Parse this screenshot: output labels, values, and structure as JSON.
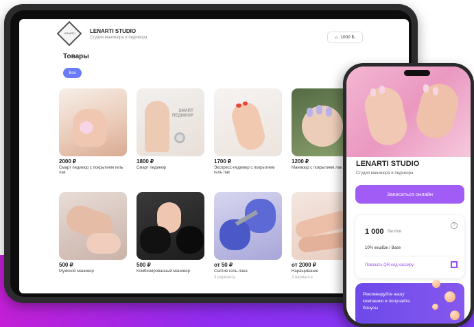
{
  "tablet": {
    "brand": "LENARTI STUDIO",
    "brand_sub": "Студия маникюра и педикюра",
    "logo_text": "LENARTI",
    "points": "1000 Б.",
    "section_title": "Товары",
    "filter_chip": "Все",
    "products": [
      {
        "price": "2000 ₽",
        "name": "Смарт педикюр с покрытием гель лак",
        "sub": ""
      },
      {
        "price": "1800 ₽",
        "name": "Смарт педикюр",
        "sub": "",
        "overlay": "SMART\nПЕДИКЮР"
      },
      {
        "price": "1700 ₽",
        "name": "Экспресс-педикюр с покрытием гель лак",
        "sub": ""
      },
      {
        "price": "1200 ₽",
        "name": "Маникюр с покрытием лак",
        "sub": ""
      },
      {
        "price": "500 ₽",
        "name": "Мужской маникюр",
        "sub": ""
      },
      {
        "price": "500 ₽",
        "name": "Комбинированный маникюр",
        "sub": ""
      },
      {
        "price": "от 50 ₽",
        "name": "Снятие гель-лака",
        "sub": "3 варианта"
      },
      {
        "price": "от 2000 ₽",
        "name": "Наращивание",
        "sub": "3 варианта"
      }
    ]
  },
  "phone": {
    "title": "LENARTI STUDIO",
    "subtitle": "Студия маникюра и педикюра",
    "book_button": "Записаться онлайн",
    "bonus_value": "1 000",
    "bonus_unit": "баллов",
    "cashback": "10% кешбэк / Base",
    "qr_link": "Показать QR-код кассиру",
    "promo": "Рекомендуйте нашу компанию и получайте бонусы"
  },
  "colors": {
    "accent": "#a25cf6",
    "chip": "#6a7bf7",
    "stripe_left": "#c21fd6",
    "stripe_right": "#7b3ef5"
  }
}
